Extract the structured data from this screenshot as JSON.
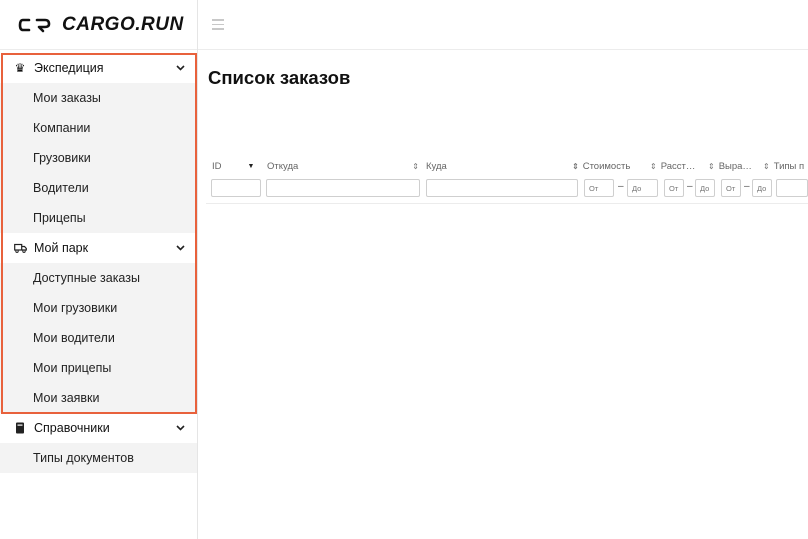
{
  "brand": {
    "name": "CARGO.RUN"
  },
  "sidebar": {
    "groups": [
      {
        "label": "Экспедиция",
        "icon": "crown-icon",
        "items": [
          "Мои заказы",
          "Компании",
          "Грузовики",
          "Водители",
          "Прицепы"
        ]
      },
      {
        "label": "Мой парк",
        "icon": "truck-icon",
        "items": [
          "Доступные заказы",
          "Мои грузовики",
          "Мои водители",
          "Мои прицепы",
          "Мои заявки"
        ]
      },
      {
        "label": "Справочники",
        "icon": "book-icon",
        "items": [
          "Типы документов"
        ]
      }
    ],
    "highlight_color": "#e8613c"
  },
  "main": {
    "title": "Список заказов",
    "columns": [
      "ID",
      "Откуда",
      "Куда",
      "Стоимость",
      "Расст…",
      "Выра…",
      "Типы п"
    ],
    "filters": {
      "from_placeholder": "От",
      "to_placeholder": "До",
      "separator": "–"
    }
  }
}
